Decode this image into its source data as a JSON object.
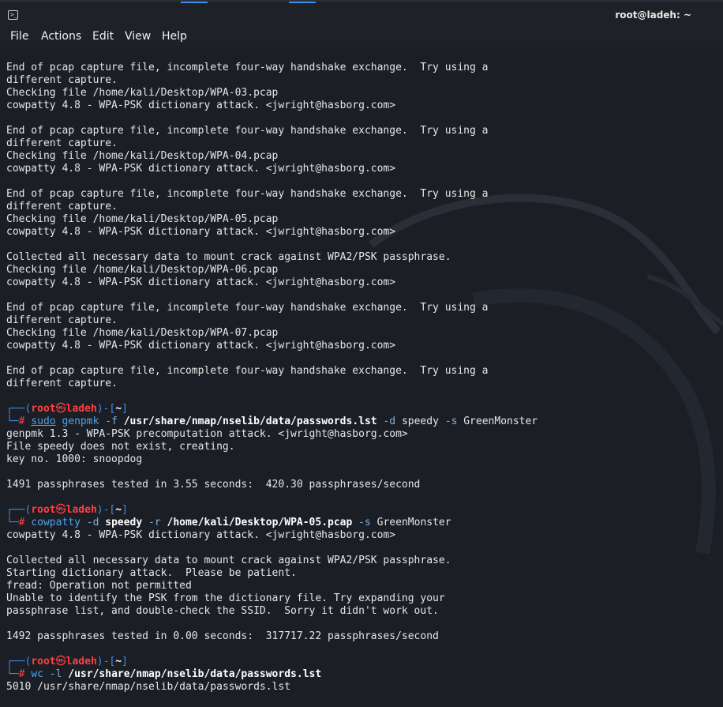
{
  "window": {
    "title": "root@ladeh: ~"
  },
  "menu": [
    "File",
    "Actions",
    "Edit",
    "View",
    "Help"
  ],
  "output_block_1": [
    "End of pcap capture file, incomplete four-way handshake exchange.  Try using a",
    "different capture.",
    "Checking file /home/kali/Desktop/WPA-03.pcap",
    "cowpatty 4.8 - WPA-PSK dictionary attack. <jwright@hasborg.com>",
    "",
    "End of pcap capture file, incomplete four-way handshake exchange.  Try using a",
    "different capture.",
    "Checking file /home/kali/Desktop/WPA-04.pcap",
    "cowpatty 4.8 - WPA-PSK dictionary attack. <jwright@hasborg.com>",
    "",
    "End of pcap capture file, incomplete four-way handshake exchange.  Try using a",
    "different capture.",
    "Checking file /home/kali/Desktop/WPA-05.pcap",
    "cowpatty 4.8 - WPA-PSK dictionary attack. <jwright@hasborg.com>",
    "",
    "Collected all necessary data to mount crack against WPA2/PSK passphrase.",
    "Checking file /home/kali/Desktop/WPA-06.pcap",
    "cowpatty 4.8 - WPA-PSK dictionary attack. <jwright@hasborg.com>",
    "",
    "End of pcap capture file, incomplete four-way handshake exchange.  Try using a",
    "different capture.",
    "Checking file /home/kali/Desktop/WPA-07.pcap",
    "cowpatty 4.8 - WPA-PSK dictionary attack. <jwright@hasborg.com>",
    "",
    "End of pcap capture file, incomplete four-way handshake exchange.  Try using a",
    "different capture.",
    ""
  ],
  "prompt": {
    "open": "┌──(",
    "user": "root",
    "at": "㉿",
    "host": "ladeh",
    "mid": ")-[",
    "dir": "~",
    "close": "]",
    "second": "└─",
    "hash": "#"
  },
  "cmd1": {
    "sudo": "sudo",
    "prog": "genpmk",
    "f": "-f",
    "file": "/usr/share/nmap/nselib/data/passwords.lst",
    "d": "-d",
    "dval": "speedy",
    "s": "-s",
    "sval": "GreenMonster"
  },
  "output_block_2": [
    "genpmk 1.3 - WPA-PSK precomputation attack. <jwright@hasborg.com>",
    "File speedy does not exist, creating.",
    "key no. 1000: snoopdog",
    "",
    "1491 passphrases tested in 3.55 seconds:  420.30 passphrases/second",
    ""
  ],
  "cmd2": {
    "prog": "cowpatty",
    "d": "-d",
    "dval": "speedy",
    "r": "-r",
    "rval": "/home/kali/Desktop/WPA-05.pcap",
    "s": "-s",
    "sval": "GreenMonster"
  },
  "output_block_3": [
    "cowpatty 4.8 - WPA-PSK dictionary attack. <jwright@hasborg.com>",
    "",
    "Collected all necessary data to mount crack against WPA2/PSK passphrase.",
    "Starting dictionary attack.  Please be patient.",
    "fread: Operation not permitted",
    "Unable to identify the PSK from the dictionary file. Try expanding your",
    "passphrase list, and double-check the SSID.  Sorry it didn't work out.",
    "",
    "1492 passphrases tested in 0.00 seconds:  317717.22 passphrases/second",
    ""
  ],
  "cmd3": {
    "prog": "wc",
    "l": "-l",
    "file": "/usr/share/nmap/nselib/data/passwords.lst"
  },
  "output_block_4": [
    "5010 /usr/share/nmap/nselib/data/passwords.lst"
  ]
}
